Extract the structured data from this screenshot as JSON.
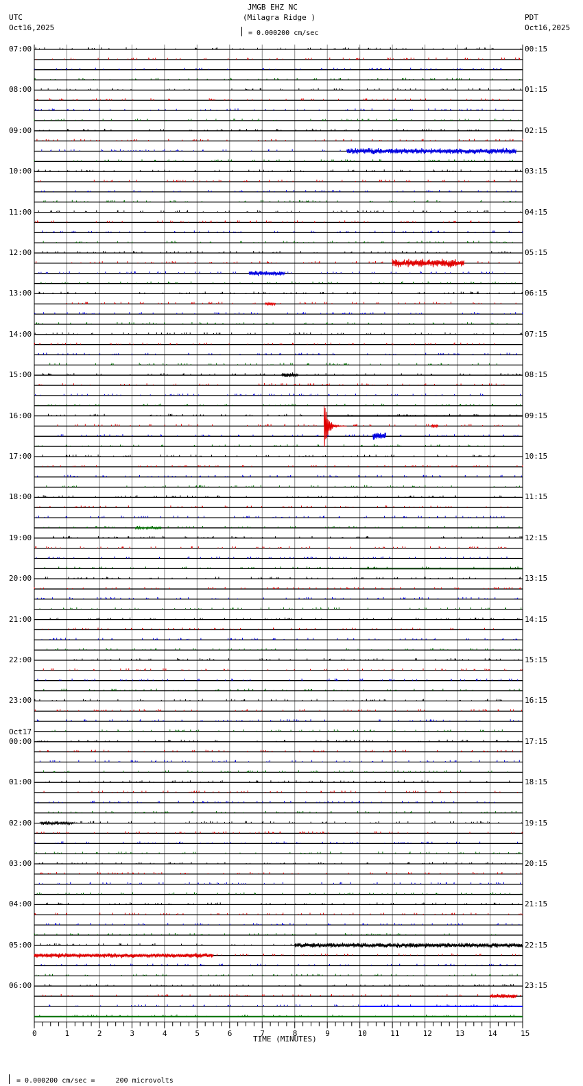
{
  "header": {
    "station": "JMGB EHZ NC",
    "location": "(Milagra Ridge )",
    "scale": "= 0.000200 cm/sec",
    "left_tz": "UTC",
    "left_date": "Oct16,2025",
    "right_tz": "PDT",
    "right_date": "Oct16,2025"
  },
  "footer": {
    "scale_note": "= 0.000200 cm/sec =     200 microvolts"
  },
  "chart_data": {
    "type": "line",
    "title": "JMGB EHZ NC (Milagra Ridge )",
    "xlabel": "TIME (MINUTES)",
    "xlim": [
      0,
      15
    ],
    "x_ticks": [
      "0",
      "1",
      "2",
      "3",
      "4",
      "5",
      "6",
      "7",
      "8",
      "9",
      "10",
      "11",
      "12",
      "13",
      "14",
      "15"
    ],
    "trace_minutes": 15,
    "trace_count": 96,
    "trace_colors": [
      "#000000",
      "#e00000",
      "#0000e0",
      "#007000"
    ],
    "left_labels": [
      "07:00",
      "08:00",
      "09:00",
      "10:00",
      "11:00",
      "12:00",
      "13:00",
      "14:00",
      "15:00",
      "16:00",
      "17:00",
      "18:00",
      "19:00",
      "20:00",
      "21:00",
      "22:00",
      "23:00",
      "00:00",
      "01:00",
      "02:00",
      "03:00",
      "04:00",
      "05:00",
      "06:00"
    ],
    "left_date_change": {
      "hour_index": 17,
      "label": "Oct17"
    },
    "right_labels": [
      "00:15",
      "01:15",
      "02:15",
      "03:15",
      "04:15",
      "05:15",
      "06:15",
      "07:15",
      "08:15",
      "09:15",
      "10:15",
      "11:15",
      "12:15",
      "13:15",
      "14:15",
      "15:15",
      "16:15",
      "17:15",
      "18:15",
      "19:15",
      "20:15",
      "21:15",
      "22:15",
      "23:15"
    ],
    "events": [
      {
        "trace": 10,
        "start": 9.6,
        "end": 14.8,
        "amp": 5
      },
      {
        "trace": 21,
        "start": 11.0,
        "end": 13.2,
        "amp": 7
      },
      {
        "trace": 22,
        "start": 6.6,
        "end": 7.7,
        "amp": 4
      },
      {
        "trace": 25,
        "start": 7.1,
        "end": 7.4,
        "amp": 3
      },
      {
        "trace": 32,
        "start": 7.6,
        "end": 8.1,
        "amp": 4
      },
      {
        "trace": 37,
        "start": 8.9,
        "end": 9.6,
        "amp": 40
      },
      {
        "trace": 37,
        "start": 12.2,
        "end": 12.4,
        "amp": 3
      },
      {
        "trace": 38,
        "start": 10.4,
        "end": 10.8,
        "amp": 6
      },
      {
        "trace": 47,
        "start": 3.1,
        "end": 3.9,
        "amp": 2
      },
      {
        "trace": 76,
        "start": 0.2,
        "end": 1.2,
        "amp": 3
      },
      {
        "trace": 88,
        "start": 8.0,
        "end": 15.0,
        "amp": 4
      },
      {
        "trace": 89,
        "start": 0.0,
        "end": 5.5,
        "amp": 4
      },
      {
        "trace": 93,
        "start": 14.0,
        "end": 14.8,
        "amp": 4
      }
    ],
    "flat_segments": [
      {
        "trace": 36,
        "start": 9.0,
        "end": 15.0,
        "color": "#000000"
      },
      {
        "trace": 51,
        "start": 10.0,
        "end": 15.0,
        "color": "#003000"
      },
      {
        "trace": 94,
        "start": 10.0,
        "end": 15.0,
        "color": "#0000ff"
      },
      {
        "trace": 95,
        "start": 0.0,
        "end": 15.0,
        "color": "#007000"
      }
    ]
  }
}
